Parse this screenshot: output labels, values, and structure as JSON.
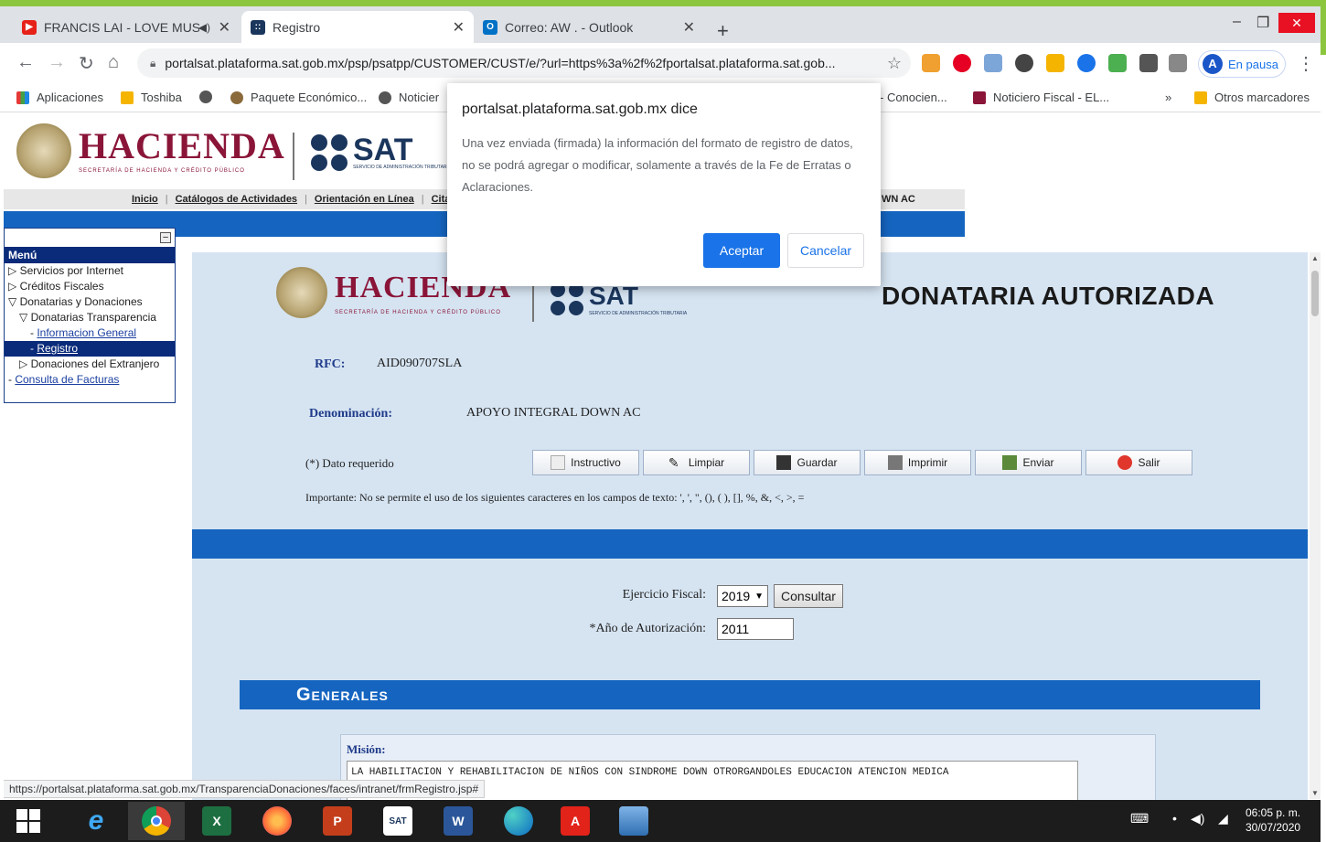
{
  "browser": {
    "tabs": [
      {
        "label": "FRANCIS LAI - LOVE MUSIC",
        "icon": "youtube-icon",
        "active": false
      },
      {
        "label": "Registro",
        "icon": "sat-icon",
        "active": true
      },
      {
        "label": "Correo: AW . - Outlook",
        "icon": "outlook-icon",
        "active": false
      }
    ],
    "new_tab": "+",
    "url": "portalsat.plataforma.sat.gob.mx/psp/psatpp/CUSTOMER/CUST/e/?url=https%3a%2f%2fportalsat.plataforma.sat.gob...",
    "profile_initial": "A",
    "profile_label": "En pausa"
  },
  "bookmarks": [
    {
      "label": "Aplicaciones",
      "icon": "apps-icon"
    },
    {
      "label": "Toshiba",
      "icon": "folder-icon"
    },
    {
      "label": "",
      "icon": "globe-icon"
    },
    {
      "label": "Paquete Económico...",
      "icon": "seal-icon"
    },
    {
      "label": "Noticier",
      "icon": "globe-icon"
    },
    {
      "label": "- Conocien...",
      "icon": "none"
    },
    {
      "label": "Noticiero Fiscal - EL...",
      "icon": "news-icon"
    },
    {
      "label": "»",
      "icon": "none"
    },
    {
      "label": "Otros marcadores",
      "icon": "folder-icon"
    }
  ],
  "header": {
    "hacienda": "HACIENDA",
    "hacienda_sub": "SECRETARÍA DE HACIENDA Y CRÉDITO PÚBLICO",
    "sat": "SAT",
    "sat_sub": "SERVICIO DE ADMINISTRACIÓN TRIBUTARIA"
  },
  "topmenu": {
    "items": [
      "Inicio",
      "Catálogos de Actividades",
      "Orientación en Línea",
      "Citas"
    ],
    "tail": "WN AC"
  },
  "sidebar": {
    "title": "Menú",
    "items": [
      {
        "label": "Servicios por Internet",
        "level": 1
      },
      {
        "label": "Créditos Fiscales",
        "level": 1
      },
      {
        "label": "Donatarias y Donaciones",
        "level": 1
      },
      {
        "label": "Donatarias Transparencia",
        "level": 2
      },
      {
        "label": "Informacion General",
        "level": 3
      },
      {
        "label": "Registro",
        "level": 3
      },
      {
        "label": "Donaciones del Extranjero",
        "level": 2
      },
      {
        "label": "Consulta de Facturas",
        "level": 1
      }
    ]
  },
  "form": {
    "title": "DONATARIA AUTORIZADA",
    "rfc_label": "RFC:",
    "rfc_value": "AID090707SLA",
    "denom_label": "Denominación:",
    "denom_value": "APOYO INTEGRAL DOWN AC",
    "required_note": "(*) Dato requerido",
    "buttons": [
      "Instructivo",
      "Limpiar",
      "Guardar",
      "Imprimir",
      "Enviar",
      "Salir"
    ],
    "important": "Importante: No se permite el uso de los siguientes caracteres en los campos de texto: ', ', \", (), ( ), [], %, &, <, >, =",
    "ejercicio_label": "Ejercicio Fiscal:",
    "ejercicio_value": "2019",
    "consultar": "Consultar",
    "anio_label": "*Año de Autorización:",
    "anio_value": "2011",
    "generales": "Generales",
    "mision_label": "Misión:",
    "mision_value": "LA HABILITACION Y REHABILITACION DE NIÑOS CON SINDROME DOWN OTRORGANDOLES EDUCACION ATENCION MEDICA"
  },
  "status_url": "https://portalsat.plataforma.sat.gob.mx/TransparenciaDonaciones/faces/intranet/frmRegistro.jsp#",
  "dialog": {
    "title": "portalsat.plataforma.sat.gob.mx dice",
    "message_1": "Una vez enviada (firmada) la información del formato de registro de datos,",
    "message_2": "no se podrá agregar o modificar, solamente a través de la Fe de Erratas o Aclaraciones.",
    "ok": "Aceptar",
    "cancel": "Cancelar"
  },
  "taskbar": {
    "time": "06:05 p. m.",
    "date": "30/07/2020"
  },
  "colors": {
    "accent_blue": "#1565c0",
    "hacienda_red": "#8a1538",
    "sat_navy": "#1b365d",
    "chrome_blue": "#1a73e8"
  }
}
